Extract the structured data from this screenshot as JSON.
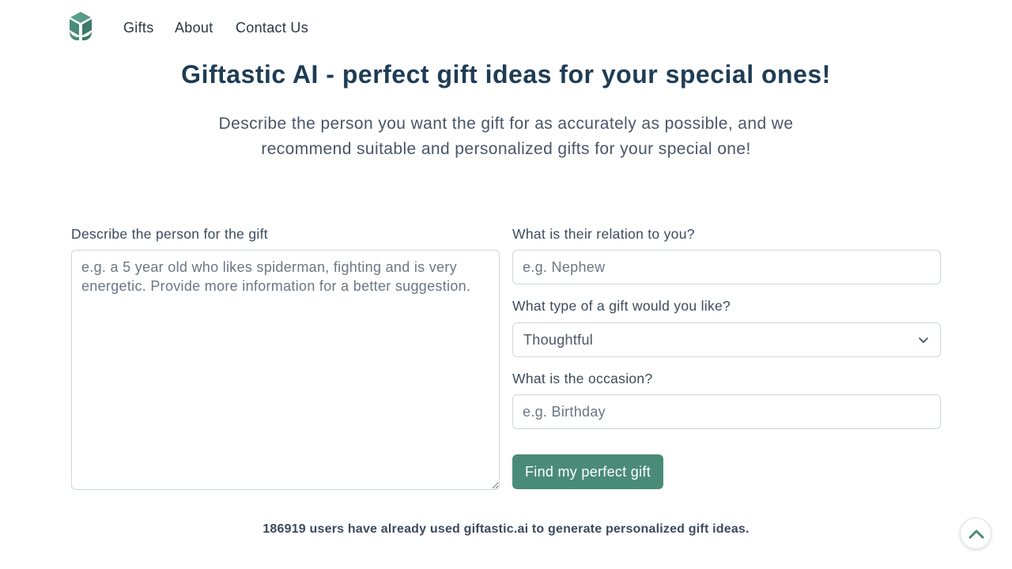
{
  "nav": {
    "logo_icon": "geometric-box-logo-icon",
    "links": [
      "Gifts",
      "About",
      "Contact Us"
    ]
  },
  "hero": {
    "title": "Giftastic AI - perfect gift ideas for your special ones!",
    "subtitle": "Describe the person you want the gift for as accurately as possible, and we recommend suitable and personalized gifts for your special one!"
  },
  "form": {
    "description_label": "Describe the person for the gift",
    "description_placeholder": "e.g. a 5 year old who likes spiderman, fighting and is very energetic. Provide more information for a better suggestion.",
    "relation_label": "What is their relation to you?",
    "relation_placeholder": "e.g. Nephew",
    "type_label": "What type of a gift would you like?",
    "type_value": "Thoughtful",
    "occasion_label": "What is the occasion?",
    "occasion_placeholder": "e.g. Birthday",
    "submit_label": "Find my perfect gift"
  },
  "footer": {
    "note": "186919 users have already used giftastic.ai to generate personalized gift ideas."
  },
  "colors": {
    "brand": "#4a8b78",
    "title": "#1f3c55"
  }
}
